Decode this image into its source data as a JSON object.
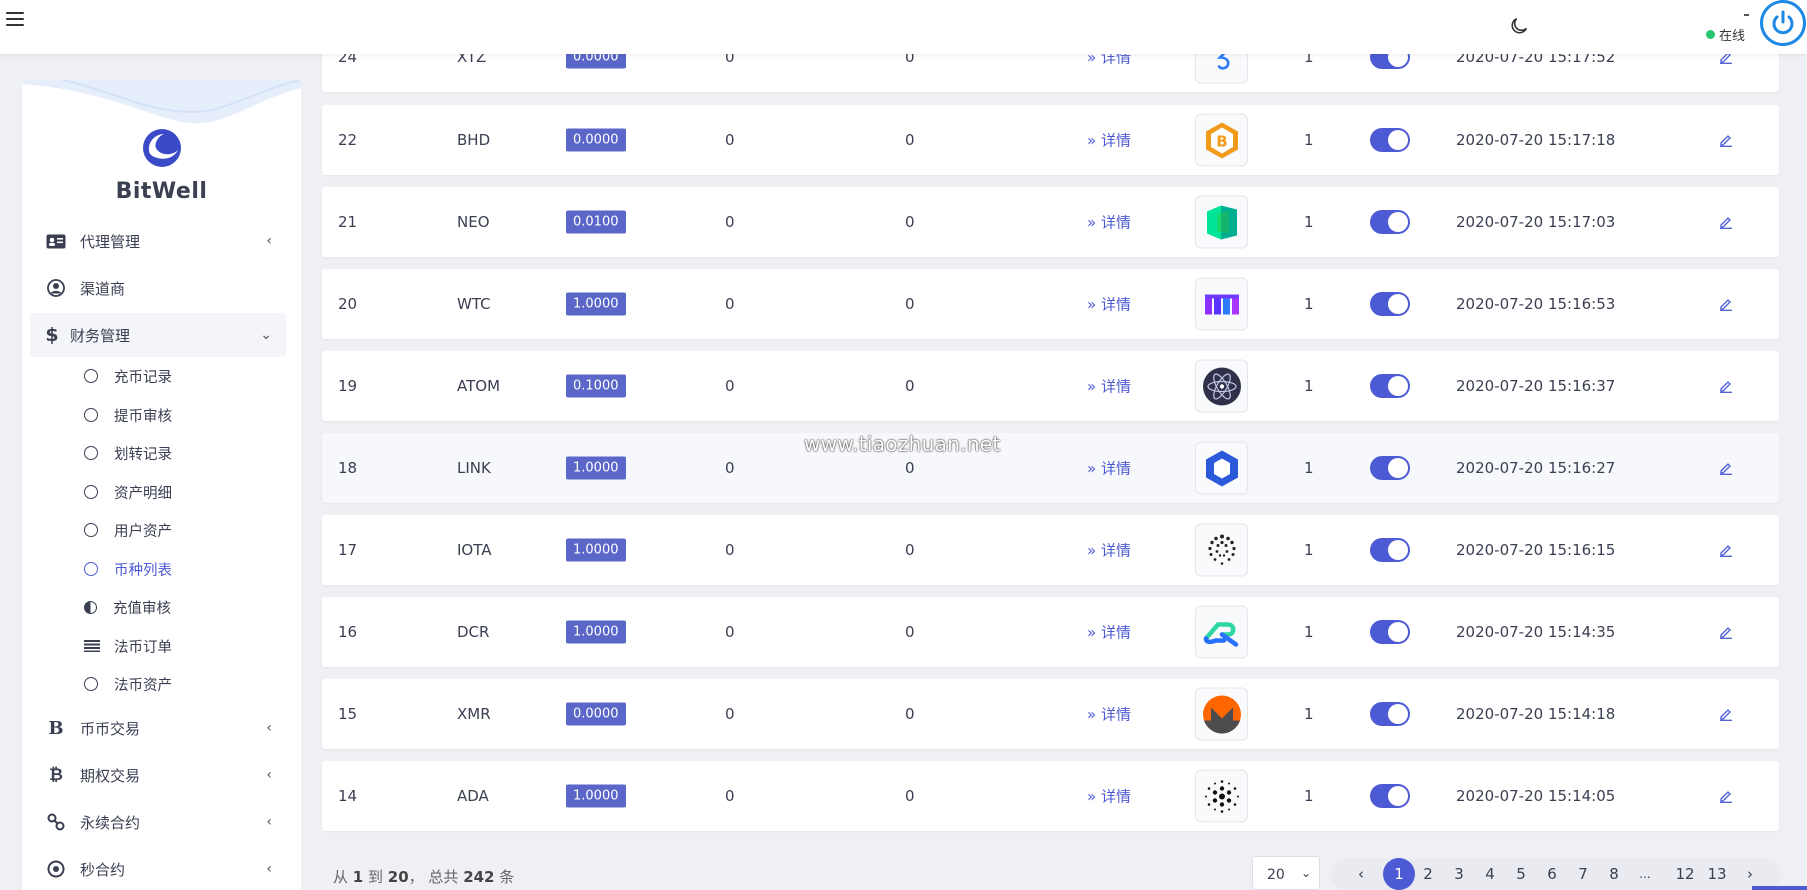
{
  "topbar": {
    "status": "在线"
  },
  "sidebar": {
    "brand": "BitWell",
    "items": [
      {
        "label": "代理管理",
        "icon": "id-card-icon"
      },
      {
        "label": "渠道商",
        "icon": "user-circle-icon"
      },
      {
        "label": "财务管理",
        "icon": "dollar-icon"
      },
      {
        "label": "币币交易",
        "icon": "bitcoin-b-icon"
      },
      {
        "label": "期权交易",
        "icon": "bitcoin-icon"
      },
      {
        "label": "永续合约",
        "icon": "link-icon"
      },
      {
        "label": "秒合约",
        "icon": "dot-circle-icon"
      }
    ],
    "sub_items": [
      {
        "label": "充币记录"
      },
      {
        "label": "提币审核"
      },
      {
        "label": "划转记录"
      },
      {
        "label": "资产明细"
      },
      {
        "label": "用户资产"
      },
      {
        "label": "币种列表"
      },
      {
        "label": "充值审核"
      },
      {
        "label": "法币订单"
      },
      {
        "label": "法币资产"
      }
    ]
  },
  "table": {
    "detail_label": "» 详情",
    "rows": [
      {
        "id": "24",
        "name": "XTZ",
        "fee": "0.0000",
        "a": "0",
        "b": "0",
        "count": "1",
        "time": "2020-07-20 15:17:52",
        "icon": "xtz-icon"
      },
      {
        "id": "22",
        "name": "BHD",
        "fee": "0.0000",
        "a": "0",
        "b": "0",
        "count": "1",
        "time": "2020-07-20 15:17:18",
        "icon": "bhd-icon"
      },
      {
        "id": "21",
        "name": "NEO",
        "fee": "0.0100",
        "a": "0",
        "b": "0",
        "count": "1",
        "time": "2020-07-20 15:17:03",
        "icon": "neo-icon"
      },
      {
        "id": "20",
        "name": "WTC",
        "fee": "1.0000",
        "a": "0",
        "b": "0",
        "count": "1",
        "time": "2020-07-20 15:16:53",
        "icon": "wtc-icon"
      },
      {
        "id": "19",
        "name": "ATOM",
        "fee": "0.1000",
        "a": "0",
        "b": "0",
        "count": "1",
        "time": "2020-07-20 15:16:37",
        "icon": "atom-icon"
      },
      {
        "id": "18",
        "name": "LINK",
        "fee": "1.0000",
        "a": "0",
        "b": "0",
        "count": "1",
        "time": "2020-07-20 15:16:27",
        "icon": "link-coin-icon"
      },
      {
        "id": "17",
        "name": "IOTA",
        "fee": "1.0000",
        "a": "0",
        "b": "0",
        "count": "1",
        "time": "2020-07-20 15:16:15",
        "icon": "iota-icon"
      },
      {
        "id": "16",
        "name": "DCR",
        "fee": "1.0000",
        "a": "0",
        "b": "0",
        "count": "1",
        "time": "2020-07-20 15:14:35",
        "icon": "dcr-icon"
      },
      {
        "id": "15",
        "name": "XMR",
        "fee": "0.0000",
        "a": "0",
        "b": "0",
        "count": "1",
        "time": "2020-07-20 15:14:18",
        "icon": "xmr-icon"
      },
      {
        "id": "14",
        "name": "ADA",
        "fee": "1.0000",
        "a": "0",
        "b": "0",
        "count": "1",
        "time": "2020-07-20 15:14:05",
        "icon": "ada-icon"
      }
    ]
  },
  "watermark": "www.tiaozhuan.net",
  "footer": {
    "summary_prefix": "从 ",
    "from": "1",
    "summary_to": " 到 ",
    "to": "20",
    "summary_total": "， 总共 ",
    "total": "242",
    "summary_suffix": " 条",
    "page_size": "20",
    "prev": "‹",
    "next": "›",
    "pages": [
      "1",
      "2",
      "3",
      "4",
      "5",
      "6",
      "7",
      "8",
      "...",
      "12",
      "13"
    ],
    "current_page": "1"
  },
  "colors": {
    "accent": "#4c5bd4",
    "badge": "#5a67c8",
    "online": "#28c76f"
  }
}
